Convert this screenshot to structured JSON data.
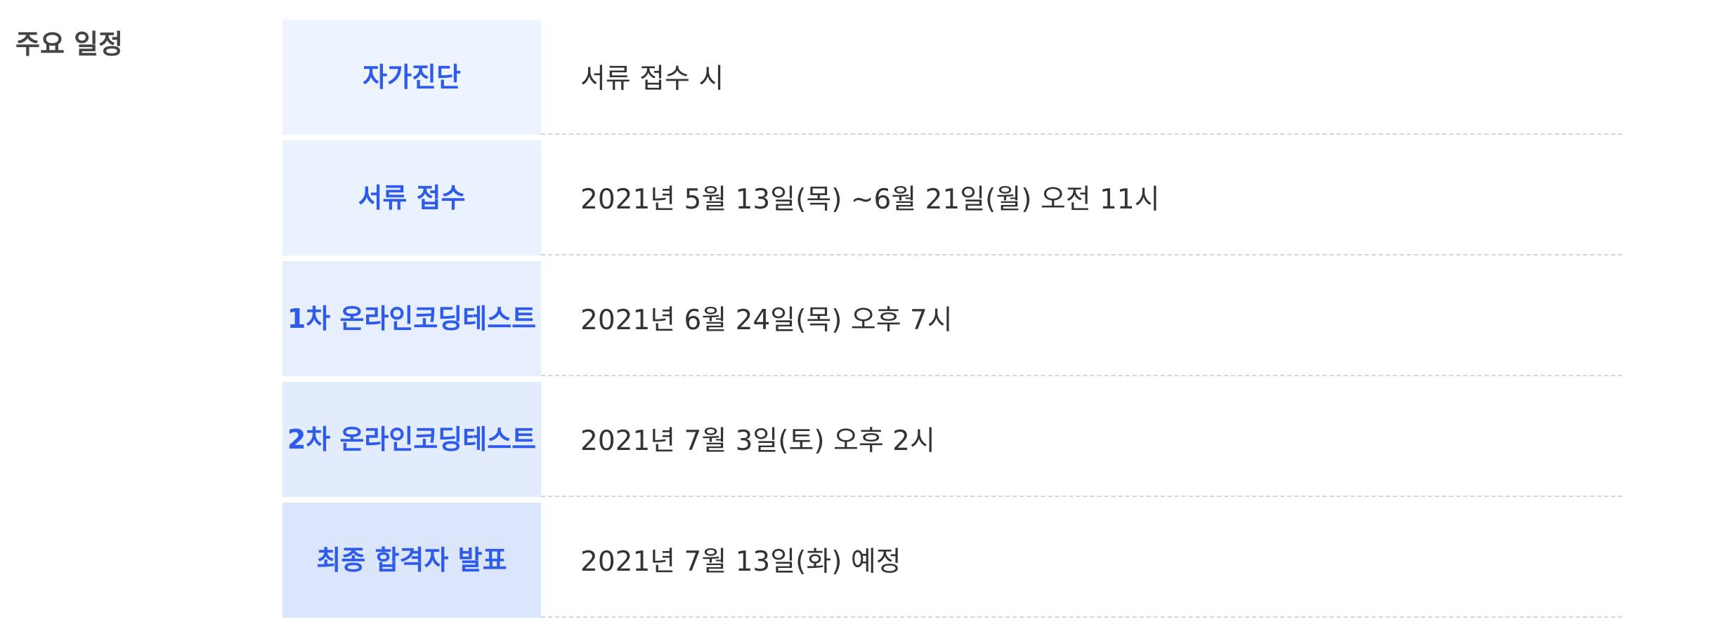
{
  "section": {
    "title": "주요 일정"
  },
  "schedule": {
    "rows": [
      {
        "label_lines": [
          "자가진단"
        ],
        "value": "서류 접수 시",
        "bg": "#edf3ff"
      },
      {
        "label_lines": [
          "서류 접수"
        ],
        "value": "2021년 5월 13일(목) ~6월 21일(월) 오전 11시",
        "bg": "#eaf1ff"
      },
      {
        "label_lines": [
          "1차 온라인",
          "코딩테스트"
        ],
        "value": "2021년 6월 24일(목) 오후 7시",
        "bg": "#e7efff"
      },
      {
        "label_lines": [
          "2차 온라인",
          "코딩테스트"
        ],
        "value": "2021년 7월 3일(토) 오후 2시",
        "bg": "#e3ecfc"
      },
      {
        "label_lines": [
          "최종 합격자 발표"
        ],
        "value": "2021년 7월 13일(화) 예정",
        "bg": "#dce6fa"
      }
    ]
  },
  "colors": {
    "accent": "#2e5bea",
    "label_text": "#444444",
    "value_text": "#333333",
    "divider": "#d6d6d6"
  }
}
